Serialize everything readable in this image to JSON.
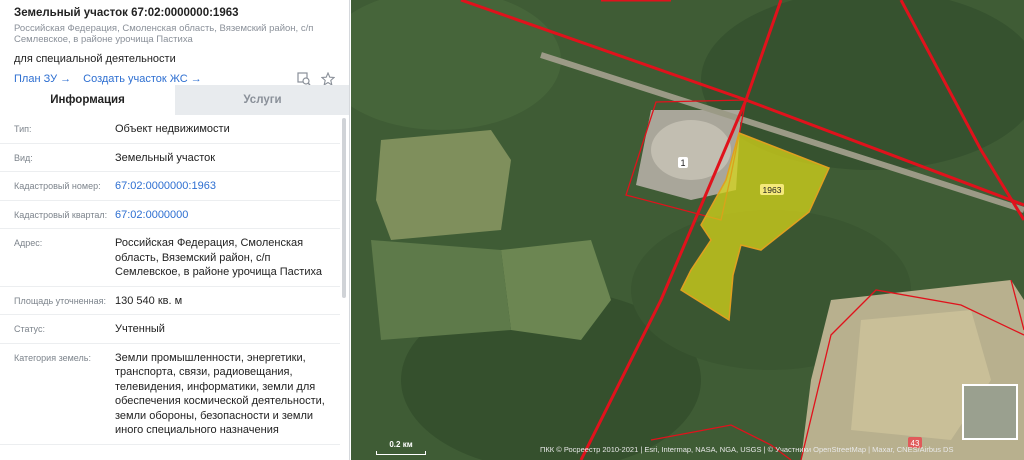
{
  "header": {
    "title": "Земельный участок 67:02:0000000:1963",
    "address_sub": "Российская Федерация, Смоленская область, Вяземский район, с/п Семлевское, в районе урочища Пастиха",
    "purpose": "для специальной деятельности",
    "links": [
      "План ЗУ →",
      "Создать участок ЖС →"
    ],
    "icons": [
      "zoom-to-icon",
      "star-icon"
    ]
  },
  "tabs": [
    {
      "label": "Информация",
      "active": true
    },
    {
      "label": "Услуги",
      "active": false
    }
  ],
  "rows": [
    {
      "label": "Тип:",
      "value": "Объект недвижимости",
      "link": false
    },
    {
      "label": "Вид:",
      "value": "Земельный участок",
      "link": false
    },
    {
      "label": "Кадастровый номер:",
      "value": "67:02:0000000:1963",
      "link": true
    },
    {
      "label": "Кадастровый квартал:",
      "value": "67:02:0000000",
      "link": true
    },
    {
      "label": "Адрес:",
      "value": "Российская Федерация, Смоленская область, Вяземский район, с/п Семлевское, в районе урочища Пастиха",
      "link": false
    },
    {
      "label": "Площадь уточненная:",
      "value": "130 540 кв. м",
      "link": false
    },
    {
      "label": "Статус:",
      "value": "Учтенный",
      "link": false
    },
    {
      "label": "Категория земель:",
      "value": "Земли промышленности, энергетики, транспорта, связи, радиовещания, телевидения, информатики, земли для обеспечения космической деятельности, земли обороны, безопасности и земли иного специального назначения",
      "link": false
    }
  ],
  "map": {
    "parcel_labels": [
      "1",
      "1963",
      "43"
    ],
    "scale_label": "0.2 км",
    "attribution": "ПКК © Росреестр 2010-2021 | Esri, Intermap, NASA, NGA, USGS | © Участники OpenStreetMap | Maxar, CNES/Airbus DS",
    "colors": {
      "boundary": "#e0121c",
      "parcel_fill": "#d6d41a",
      "forest": "#3d5a34",
      "field": "#8f9a6a"
    }
  }
}
